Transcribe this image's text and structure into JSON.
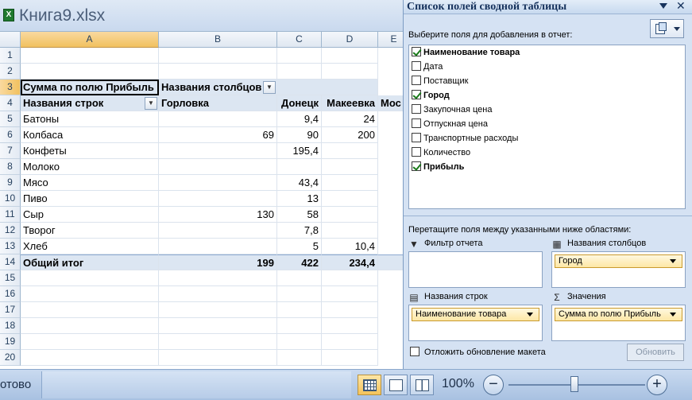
{
  "window": {
    "title": "Книга9.xlsx",
    "excel_icon": "X"
  },
  "grid": {
    "columns": [
      "A",
      "B",
      "C",
      "D",
      "E"
    ],
    "rows": [
      "1",
      "2",
      "3",
      "4",
      "5",
      "6",
      "7",
      "8",
      "9",
      "10",
      "11",
      "12",
      "13",
      "14",
      "15",
      "16",
      "17",
      "18",
      "19",
      "20"
    ],
    "pivot": {
      "values_caption": "Сумма по полю Прибыль",
      "columns_caption": "Названия столбцов",
      "rows_caption": "Названия строк",
      "column_items": [
        "Горловка",
        "Донецк",
        "Макеевка",
        "Мос"
      ],
      "data_rows": [
        {
          "label": "Батоны",
          "b": "",
          "c": "9,4",
          "d": "24"
        },
        {
          "label": "Колбаса",
          "b": "69",
          "c": "90",
          "d": "200"
        },
        {
          "label": "Конфеты",
          "b": "",
          "c": "195,4",
          "d": ""
        },
        {
          "label": "Молоко",
          "b": "",
          "c": "",
          "d": ""
        },
        {
          "label": "Мясо",
          "b": "",
          "c": "43,4",
          "d": ""
        },
        {
          "label": "Пиво",
          "b": "",
          "c": "13",
          "d": ""
        },
        {
          "label": "Сыр",
          "b": "130",
          "c": "58",
          "d": ""
        },
        {
          "label": "Творог",
          "b": "",
          "c": "7,8",
          "d": ""
        },
        {
          "label": "Хлеб",
          "b": "",
          "c": "5",
          "d": "10,4"
        }
      ],
      "grand_total": {
        "label": "Общий итог",
        "b": "199",
        "c": "422",
        "d": "234,4"
      }
    }
  },
  "statusbar": {
    "ready": "отово",
    "zoom": "100%",
    "zoom_out": "−",
    "zoom_in": "+"
  },
  "pivot_pane": {
    "title": "Список полей сводной таблицы",
    "close": "✕",
    "choose_label": "Выберите поля для добавления в отчет:",
    "fields": [
      {
        "label": "Наименование товара",
        "checked": true
      },
      {
        "label": "Дата",
        "checked": false
      },
      {
        "label": "Поставщик",
        "checked": false
      },
      {
        "label": "Город",
        "checked": true
      },
      {
        "label": "Закупочная цена",
        "checked": false
      },
      {
        "label": "Отпускная цена",
        "checked": false
      },
      {
        "label": "Транспортные расходы",
        "checked": false
      },
      {
        "label": "Количество",
        "checked": false
      },
      {
        "label": "Прибыль",
        "checked": true
      }
    ],
    "drag_label": "Перетащите поля между указанными ниже областями:",
    "areas": {
      "report_filter": {
        "label": "Фильтр отчета",
        "item": ""
      },
      "column_labels": {
        "label": "Названия столбцов",
        "item": "Город"
      },
      "row_labels": {
        "label": "Названия строк",
        "item": "Наименование товара"
      },
      "values": {
        "label": "Значения",
        "item": "Сумма по полю Прибыль"
      }
    },
    "defer_label": "Отложить обновление макета",
    "update_button": "Обновить"
  }
}
